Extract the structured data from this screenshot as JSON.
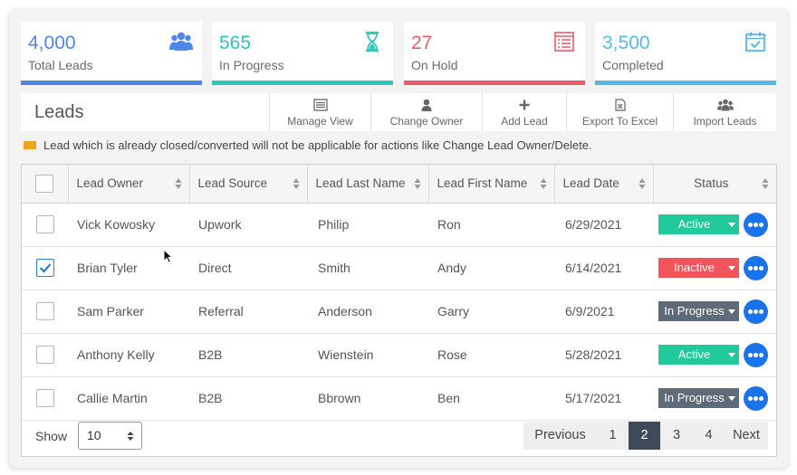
{
  "stats": [
    {
      "value": "4,000",
      "label": "Total Leads",
      "color": "#4d86ec",
      "icon": "users-icon"
    },
    {
      "value": "565",
      "label": "In Progress",
      "color": "#2cc5c0",
      "icon": "hourglass-icon"
    },
    {
      "value": "27",
      "label": "On Hold",
      "color": "#ec5b6d",
      "icon": "list-icon"
    },
    {
      "value": "3,500",
      "label": "Completed",
      "color": "#57b8e6",
      "icon": "calendar-check-icon"
    }
  ],
  "toolbar": {
    "title": "Leads",
    "actions": [
      {
        "label": "Manage View",
        "icon": "list-icon"
      },
      {
        "label": "Change Owner",
        "icon": "user-icon"
      },
      {
        "label": "Add Lead",
        "icon": "plus-icon"
      },
      {
        "label": "Export To Excel",
        "icon": "excel-file-icon"
      },
      {
        "label": "Import Leads",
        "icon": "users-icon"
      }
    ]
  },
  "notice": {
    "text": "Lead which is already closed/converted will not be applicable for actions like Change Lead Owner/Delete.",
    "color": "#f0a31f"
  },
  "table": {
    "columns": [
      "Lead Owner",
      "Lead Source",
      "Lead Last Name",
      "Lead First Name",
      "Lead Date",
      "Status"
    ],
    "rows": [
      {
        "checked": false,
        "owner": "Vick Kowosky",
        "source": "Upwork",
        "last": "Philip",
        "first": "Ron",
        "date": "6/29/2021",
        "status": "Active"
      },
      {
        "checked": true,
        "owner": "Brian Tyler",
        "source": "Direct",
        "last": "Smith",
        "first": "Andy",
        "date": "6/14/2021",
        "status": "Inactive"
      },
      {
        "checked": false,
        "owner": "Sam Parker",
        "source": "Referral",
        "last": "Anderson",
        "first": "Garry",
        "date": "6/9/2021",
        "status": "In Progress"
      },
      {
        "checked": false,
        "owner": "Anthony Kelly",
        "source": "B2B",
        "last": "Wienstein",
        "first": "Rose",
        "date": "5/28/2021",
        "status": "Active"
      },
      {
        "checked": false,
        "owner": "Callie Martin",
        "source": "B2B",
        "last": "Bbrown",
        "first": "Ben",
        "date": "5/17/2021",
        "status": "In Progress"
      }
    ],
    "status_colors": {
      "Active": "#22c99a",
      "Inactive": "#f2545b",
      "In Progress": "#5f6b79"
    }
  },
  "footer": {
    "show_label": "Show",
    "page_size": "10",
    "pager": [
      "Previous",
      "1",
      "2",
      "3",
      "4",
      "Next"
    ],
    "active_page": "2"
  }
}
